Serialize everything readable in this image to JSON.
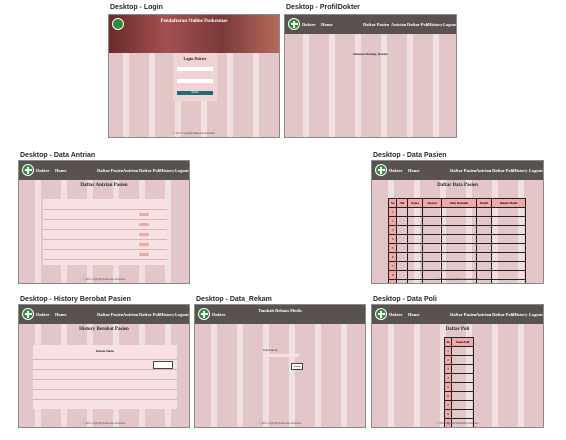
{
  "frames": {
    "login": {
      "label": "Desktop - Login",
      "hero": "Pendaftaran Online Puskesmas",
      "card_title": "Login Dokter",
      "field1": "",
      "field2": "",
      "button": "Masuk",
      "footer": "© 2021 Copyright Puskesmas Indonesia"
    },
    "profil": {
      "label": "Desktop - ProfilDokter",
      "brand": "Dokter",
      "nav": [
        "Home",
        "Daftar Pasien",
        "Antrian",
        "Daftar Poli",
        "History",
        "Logout"
      ],
      "welcome": "Selamat Datang, Dokter"
    },
    "antrian": {
      "label": "Desktop - Data Antrian",
      "brand": "Dokter",
      "nav": [
        "Home",
        "Daftar Pasien",
        "Antrian",
        "Daftar Poli",
        "History",
        "Logout"
      ],
      "title": "Daftar Antrian Pasien",
      "footer": "© 2021 Copyright Puskesmas Indonesia"
    },
    "pasien": {
      "label": "Desktop - Data Pasien",
      "brand": "Dokter",
      "nav": [
        "Home",
        "Daftar Pasien",
        "Antrian",
        "Daftar Poli",
        "History",
        "Logout"
      ],
      "title": "Daftar Data Pasien",
      "headers": [
        "No",
        "Nik",
        "Nama",
        "Alamat",
        "Jenis Kelamin",
        "Detail",
        "Rekam Medis"
      ],
      "rows": [
        "1",
        "2",
        "3",
        "4",
        "5",
        "6",
        "7",
        "8",
        "9",
        "10"
      ],
      "footer": "© 2021 Copyright Puskesmas Indonesia"
    },
    "history": {
      "label": "Desktop - History Berobat Pasien",
      "brand": "Dokter",
      "nav": [
        "Home",
        "Daftar Pasien",
        "Antrian",
        "Daftar Poli",
        "History",
        "Logout"
      ],
      "title": "History Berobat Pasien",
      "subtitle": "Rekam Medis",
      "footer": "© 2021 Copyright Puskesmas Indonesia"
    },
    "rekam": {
      "label": "Desktop - Data_Rekam",
      "brand": "Dokter",
      "title": "Tambah Rekam Medis",
      "field_label": "Rekam Medis",
      "button": "Simpan",
      "footer": "© 2021 Copyright Puskesmas Indonesia"
    },
    "poli": {
      "label": "Desktop - Data Poli",
      "brand": "Dokter",
      "nav": [
        "Home",
        "Daftar Pasien",
        "Antrian",
        "Daftar Poli",
        "History",
        "Logout"
      ],
      "title": "Daftar Poli",
      "headers": [
        "No",
        "Nama Poli"
      ],
      "rows": [
        "1",
        "2",
        "3",
        "4",
        "5",
        "6",
        "7",
        "8",
        "9",
        "10"
      ],
      "footer": "© 2021 Copyright Puskesmas Indonesia"
    }
  },
  "colors": {
    "bg": "#e3c6c8",
    "nav": "#5a5151",
    "accent": "#f0a8a8",
    "logo": "#2f8a3a"
  }
}
